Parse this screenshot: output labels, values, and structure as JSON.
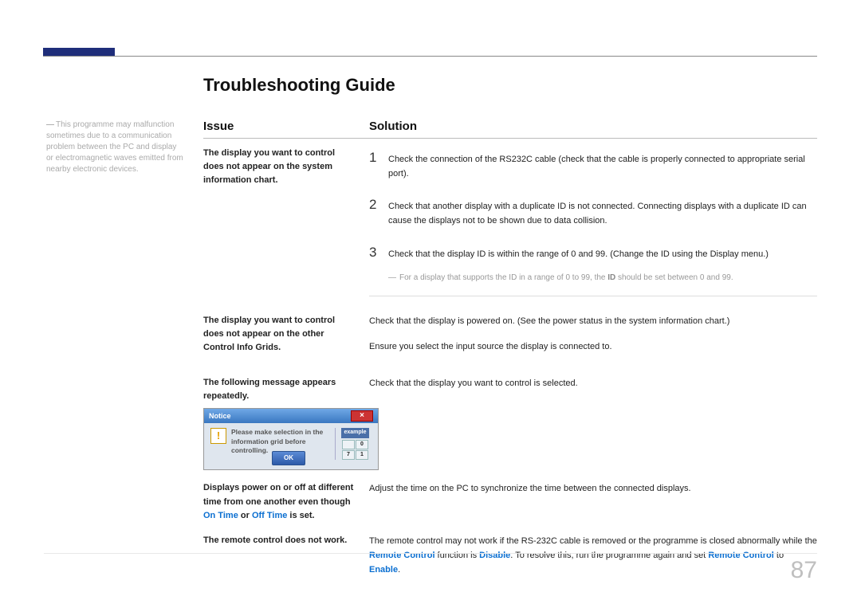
{
  "title": "Troubleshooting Guide",
  "pageNumber": "87",
  "sidebarNote": "This programme may malfunction sometimes due to a communication problem between the PC and display or electromagnetic waves emitted from nearby electronic devices.",
  "columnHeaders": {
    "issue": "Issue",
    "solution": "Solution"
  },
  "row1": {
    "issue": "The display you want to control does not appear on the system information chart.",
    "steps": {
      "n1": "1",
      "t1": "Check the connection of the RS232C cable (check that the cable is properly connected to appropriate serial port).",
      "n2": "2",
      "t2": "Check that another display with a duplicate ID is not connected. Connecting displays with a duplicate ID can cause the displays not to be shown due to data collision.",
      "n3": "3",
      "t3": "Check that the display ID is within the range of 0 and 99. (Change the ID using the Display menu.)"
    },
    "note_pre": "For a display that supports the ID in a range of 0 to 99, the ",
    "note_bold": "ID",
    "note_post": " should be set between 0 and 99."
  },
  "row2": {
    "issue": "The display you want to control does not appear on the other Control Info Grids.",
    "p1": "Check that the display is powered on. (See the power status in the system information chart.)",
    "p2": "Ensure you select the input source the display is connected to."
  },
  "row3": {
    "issue": "The following message appears repeatedly.",
    "solution": "Check that the display you want to control is selected.",
    "dialog": {
      "title": "Notice",
      "msg": "Please make selection in the information grid before controlling.",
      "exampleLabel": "example",
      "okLabel": "OK",
      "cells": {
        "a": "",
        "b": "0",
        "c": "7",
        "d": "1"
      }
    }
  },
  "row4": {
    "issue_pre": "Displays power on or off at different time from one another even though ",
    "issue_kw1": "On Time",
    "issue_mid": " or ",
    "issue_kw2": "Off Time",
    "issue_post": " is set.",
    "solution": "Adjust the time on the PC to synchronize the time between the connected displays."
  },
  "row5": {
    "issue": "The remote control does not work.",
    "sol_pre": "The remote control may not work if the RS-232C cable is removed or the programme is closed abnormally while the ",
    "kw1": "Remote Control",
    "sol_mid1": " function is ",
    "kw2": "Disable",
    "sol_mid2": ". To resolve this, run the programme again and set ",
    "kw3": "Remote Control",
    "sol_mid3": " to ",
    "kw4": "Enable",
    "sol_end": "."
  }
}
